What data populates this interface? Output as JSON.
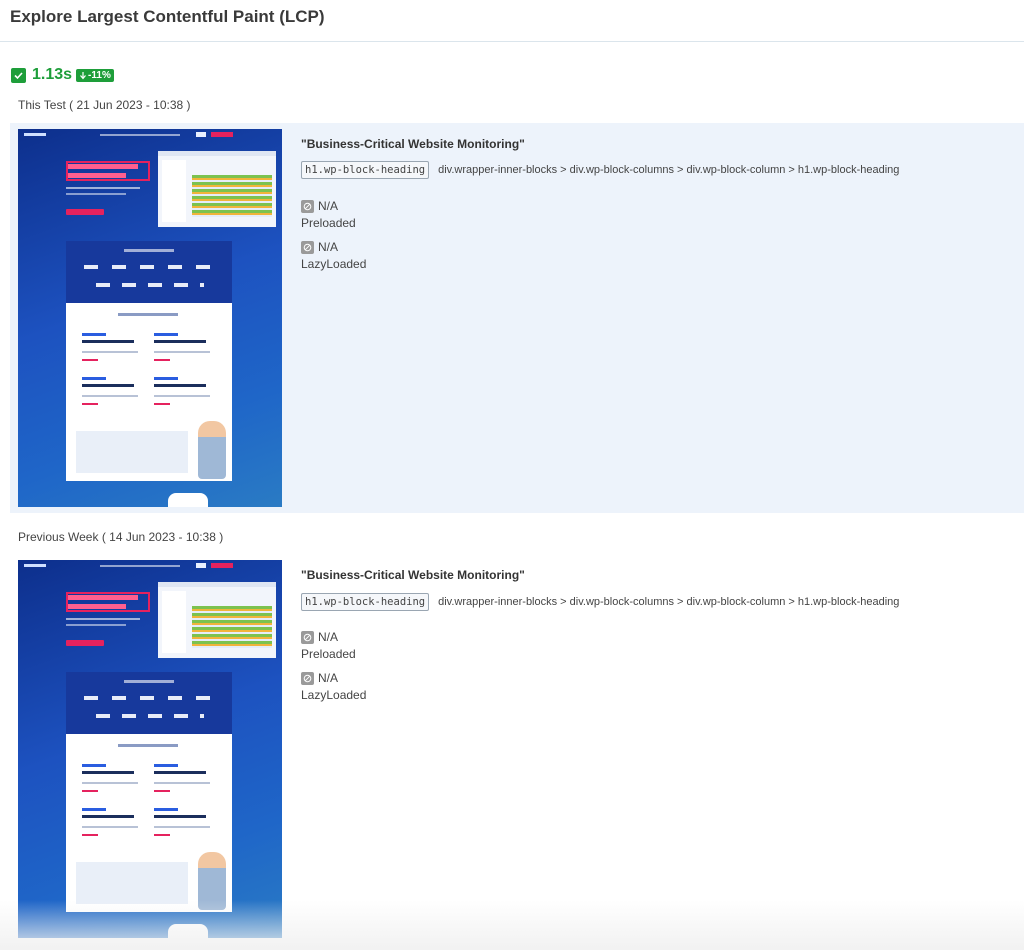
{
  "header": {
    "title": "Explore Largest Contentful Paint (LCP)"
  },
  "metric": {
    "value": "1.13s",
    "delta": "-11%",
    "status_color": "#1e9e3a",
    "icon": "check-icon",
    "delta_icon": "arrow-down-icon"
  },
  "results": [
    {
      "label": "This Test ( 21 Jun 2023 - 10:38 )",
      "screenshot_icon": "page-screenshot",
      "element_text": "\"Business-Critical Website Monitoring\"",
      "element_tag": "h1.wp-block-heading",
      "element_path": "div.wrapper-inner-blocks > div.wp-block-columns > div.wp-block-column > h1.wp-block-heading",
      "preloaded_value": "N/A",
      "preloaded_label": "Preloaded",
      "lazyloaded_value": "N/A",
      "lazyloaded_label": "LazyLoaded"
    },
    {
      "label": "Previous Week ( 14 Jun 2023 - 10:38 )",
      "screenshot_icon": "page-screenshot",
      "element_text": "\"Business-Critical Website Monitoring\"",
      "element_tag": "h1.wp-block-heading",
      "element_path": "div.wrapper-inner-blocks > div.wp-block-columns > div.wp-block-column > h1.wp-block-heading",
      "preloaded_value": "N/A",
      "preloaded_label": "Preloaded",
      "lazyloaded_value": "N/A",
      "lazyloaded_label": "LazyLoaded"
    }
  ],
  "colors": {
    "highlight_bg": "#edf3fb",
    "accent_pink": "#e5225e",
    "na_icon": "#9a9a9a"
  }
}
